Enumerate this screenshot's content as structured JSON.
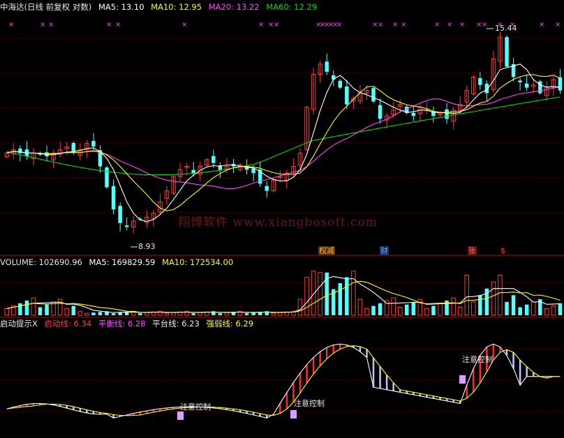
{
  "colors": {
    "up": "#ff3b3b",
    "down": "#54ffff",
    "ma5": "#ffffff",
    "ma10": "#ffff00",
    "ma20": "#ff44ff",
    "ma60": "#00dd00",
    "grid": "#8b0000",
    "divider": "#c00000",
    "hatch_red": "#ff2a2a",
    "hatch_blue": "#b8c8ff",
    "attn_box": "#d9a0ff"
  },
  "main_header": {
    "title": "中海达(日线 前复权 对数)",
    "ma5": "MA5: 13.10",
    "ma10": "MA10: 12.95",
    "ma20": "MA20: 13.22",
    "ma60": "MA60: 12.29"
  },
  "volume_header": {
    "title": "VOLUME: 102690.96",
    "ma5": "MA5: 169829.59",
    "ma10": "MA10: 172534.00"
  },
  "indicator_header": {
    "title": "启动提示X",
    "launch": "启动线: 6.34",
    "balance": "平衡线: 6.28",
    "platform": "平台线: 6.23",
    "strength": "强弱线: 6.29"
  },
  "watermark": "翔博软件 www.xiangbosoft.com",
  "annotations": {
    "low_price": "8.93",
    "high_price": "15.44",
    "attention_1": "注意控制",
    "attention_2": "注意控制",
    "attention_3": "注意控制"
  },
  "event_markers": [
    {
      "text": "权减",
      "color": "#ffaa55"
    },
    {
      "text": "财",
      "color": "#66aaff"
    },
    {
      "text": "张",
      "color": "#ff6666"
    },
    {
      "text": "$",
      "color": "#ff3333"
    }
  ],
  "chart_data": {
    "type": "candlestick",
    "price_scale": "log",
    "price_range": [
      8.5,
      15.9
    ],
    "bars": 84,
    "closes": [
      11.0,
      11.1,
      11.0,
      10.9,
      11.0,
      10.95,
      10.9,
      11.0,
      11.1,
      11.2,
      11.0,
      11.1,
      11.3,
      11.2,
      10.6,
      10.0,
      9.4,
      9.05,
      8.95,
      9.1,
      9.15,
      9.2,
      9.3,
      9.6,
      9.9,
      10.3,
      10.5,
      10.6,
      10.4,
      10.6,
      10.8,
      10.7,
      10.5,
      10.6,
      10.6,
      10.65,
      10.5,
      10.4,
      10.1,
      9.9,
      10.2,
      10.3,
      10.4,
      10.6,
      11.0,
      12.5,
      13.7,
      14.1,
      13.8,
      13.5,
      13.2,
      12.6,
      12.8,
      13.0,
      13.1,
      12.7,
      12.1,
      12.2,
      12.4,
      12.6,
      12.3,
      12.2,
      12.5,
      12.4,
      12.2,
      12.3,
      12.1,
      12.4,
      12.6,
      13.1,
      13.6,
      13.3,
      13.0,
      14.3,
      15.2,
      14.0,
      13.6,
      13.4,
      13.2,
      13.3,
      13.0,
      13.2,
      13.5,
      13.1
    ],
    "ma5_last": 13.1,
    "ma10_last": 12.95,
    "ma20_last": 13.22,
    "ma60_last": 12.29,
    "low": 8.93,
    "high": 15.44,
    "volume": {
      "last": 102690.96,
      "ma5": 169829.59,
      "ma10": 172534.0
    },
    "indicator": {
      "name": "启动提示X",
      "launch": 6.34,
      "balance": 6.28,
      "platform": 6.23,
      "strength": 6.29
    }
  }
}
